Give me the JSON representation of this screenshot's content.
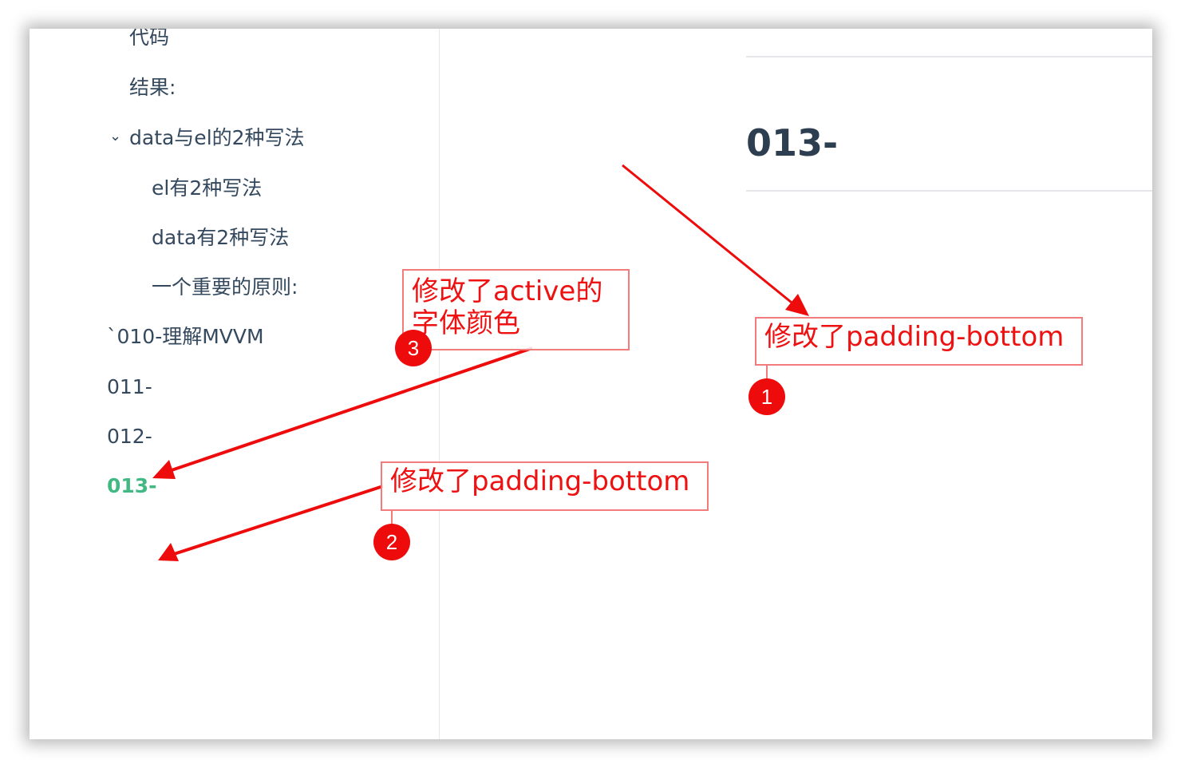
{
  "sidebar": {
    "items": [
      {
        "label": "代码"
      },
      {
        "label": "结果:"
      },
      {
        "label": "data与el的2种写法"
      },
      {
        "label": "el有2种写法"
      },
      {
        "label": "data有2种写法"
      },
      {
        "label": "一个重要的原则:"
      },
      {
        "label": "`010-理解MVVM"
      },
      {
        "label": "011-"
      },
      {
        "label": "012-"
      },
      {
        "label": "013-"
      }
    ],
    "caret_glyph": "⌄",
    "active_color": "#42b983"
  },
  "content": {
    "heading": "013-"
  },
  "annotations": {
    "one": {
      "text": "修改了padding-bottom",
      "number": "1"
    },
    "two": {
      "text": "修改了padding-bottom",
      "number": "2"
    },
    "three": {
      "text_line1": "修改了active的",
      "text_line2": "字体颜色",
      "number": "3"
    },
    "color": "#ee1111"
  }
}
